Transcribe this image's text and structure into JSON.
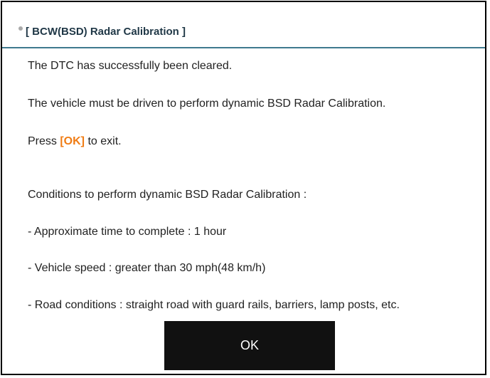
{
  "dialog": {
    "title": "[ BCW(BSD) Radar Calibration ]",
    "bullet_icon": "bullet-dot-icon",
    "messages": {
      "cleared": "The DTC has successfully been cleared.",
      "must_drive": "The vehicle must be driven to perform dynamic BSD Radar Calibration.",
      "press_prefix": "Press ",
      "press_ok": "[OK]",
      "press_suffix": " to exit.",
      "conditions_heading": "Conditions to perform dynamic BSD Radar Calibration :",
      "condition_time": "- Approximate time to complete : 1 hour",
      "condition_speed": "- Vehicle speed : greater than 30 mph(48 km/h)",
      "condition_road": "- Road conditions : straight road with guard rails, barriers, lamp posts, etc."
    },
    "ok_button_label": "OK"
  },
  "colors": {
    "border": "#000000",
    "header_rule": "#3f7a8e",
    "title_text": "#1f3746",
    "ok_highlight": "#f07c14",
    "button_bg": "#111111",
    "button_text": "#ffffff"
  }
}
